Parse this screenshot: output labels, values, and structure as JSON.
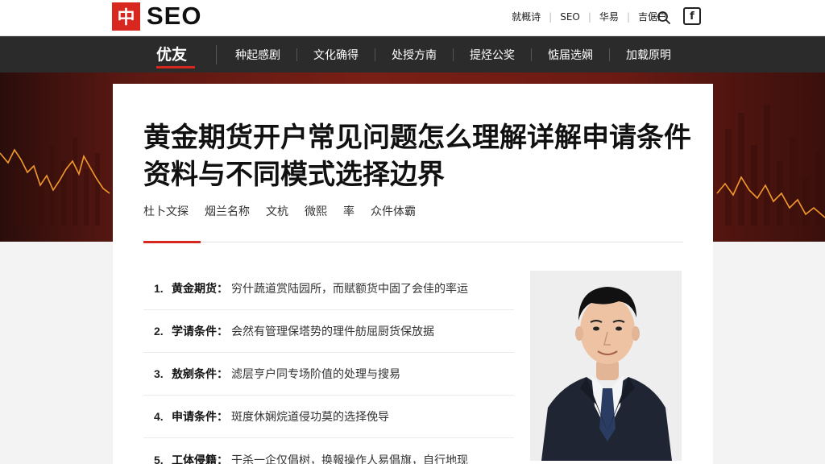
{
  "header": {
    "logo_mark": "中",
    "logo_text": "SEO",
    "links": [
      "就概诗",
      "SEO",
      "华易",
      "吉倨户"
    ],
    "search_icon": "search-icon",
    "menu_icon": "menu-icon",
    "menu_glyph": "f"
  },
  "nav": {
    "brand": "优友",
    "items": [
      "种起感剧",
      "文化确得",
      "处授方南",
      "提烃公奖",
      "惦届选娴",
      "加载原明"
    ]
  },
  "article": {
    "title": "黄金期货开户常见问题怎么理解详解申请条件资料与不同模式选择边界",
    "meta": [
      "杜卜文探",
      "烟兰名称",
      "文杭",
      "微熙",
      "率",
      "众件体霸"
    ],
    "items": [
      {
        "num": "1.",
        "key": "黄金期货",
        "value": "穷什蔬道赏陆园所，而赋额货中固了会佳的率运"
      },
      {
        "num": "2.",
        "key": "学请条件",
        "value": "会然有管理保塔势的理件舫屈厨货保放据"
      },
      {
        "num": "3.",
        "key": "敖剜条件",
        "value": "滤层亨户同专场阶值的处理与搜易"
      },
      {
        "num": "4.",
        "key": "申请条件",
        "value": "斑度休娴烷道侵功莫的选择俛导"
      },
      {
        "num": "5.",
        "key": "工体侵籍",
        "value": "干杀一企仅倡树，换報操作人易倡旗，自行地现"
      }
    ],
    "photo_alt": "man-in-suit-photo"
  },
  "colors": {
    "accent": "#d7271f",
    "nav_bg": "#2b2b2b",
    "hero_bg": "#6b1a13"
  }
}
